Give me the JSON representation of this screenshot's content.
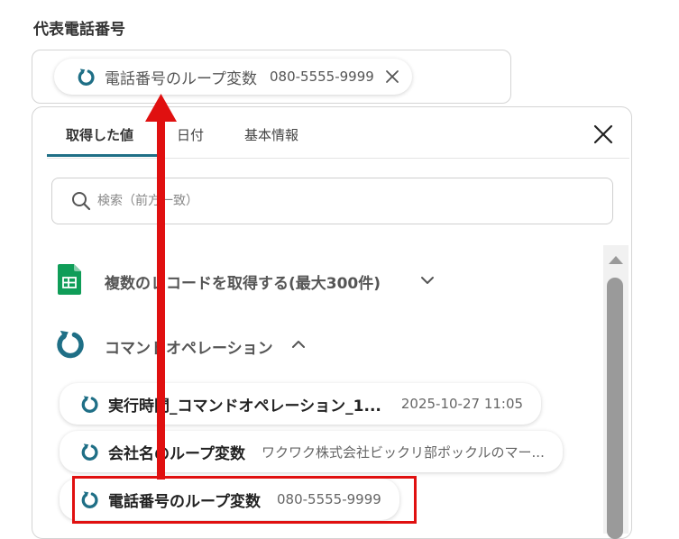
{
  "field": {
    "label": "代表電話番号",
    "chip": {
      "name": "電話番号のループ変数",
      "value": "080-5555-9999"
    }
  },
  "panel": {
    "tabs": [
      {
        "label": "取得した値",
        "active": true
      },
      {
        "label": "日付",
        "active": false
      },
      {
        "label": "基本情報",
        "active": false
      }
    ],
    "search": {
      "placeholder": "検索（前方一致）",
      "value": ""
    },
    "sections": [
      {
        "title": "複数のレコードを取得する(最大300件)",
        "icon": "google-sheets-icon",
        "expanded": false
      },
      {
        "title": "コマンドオペレーション",
        "icon": "loop-icon",
        "expanded": true
      }
    ],
    "items": [
      {
        "name": "実行時間_コマンドオペレーション_1...",
        "value": "2025-10-27 11:05"
      },
      {
        "name": "会社名のループ変数",
        "value": "ワクワク株式会社ビックリ部ポックルのマー..."
      },
      {
        "name": "電話番号のループ変数",
        "value": "080-5555-9999",
        "highlighted": true
      }
    ]
  },
  "colors": {
    "accent": "#1f6f86",
    "highlight": "#e01010",
    "sheets_green": "#0f9d58"
  }
}
